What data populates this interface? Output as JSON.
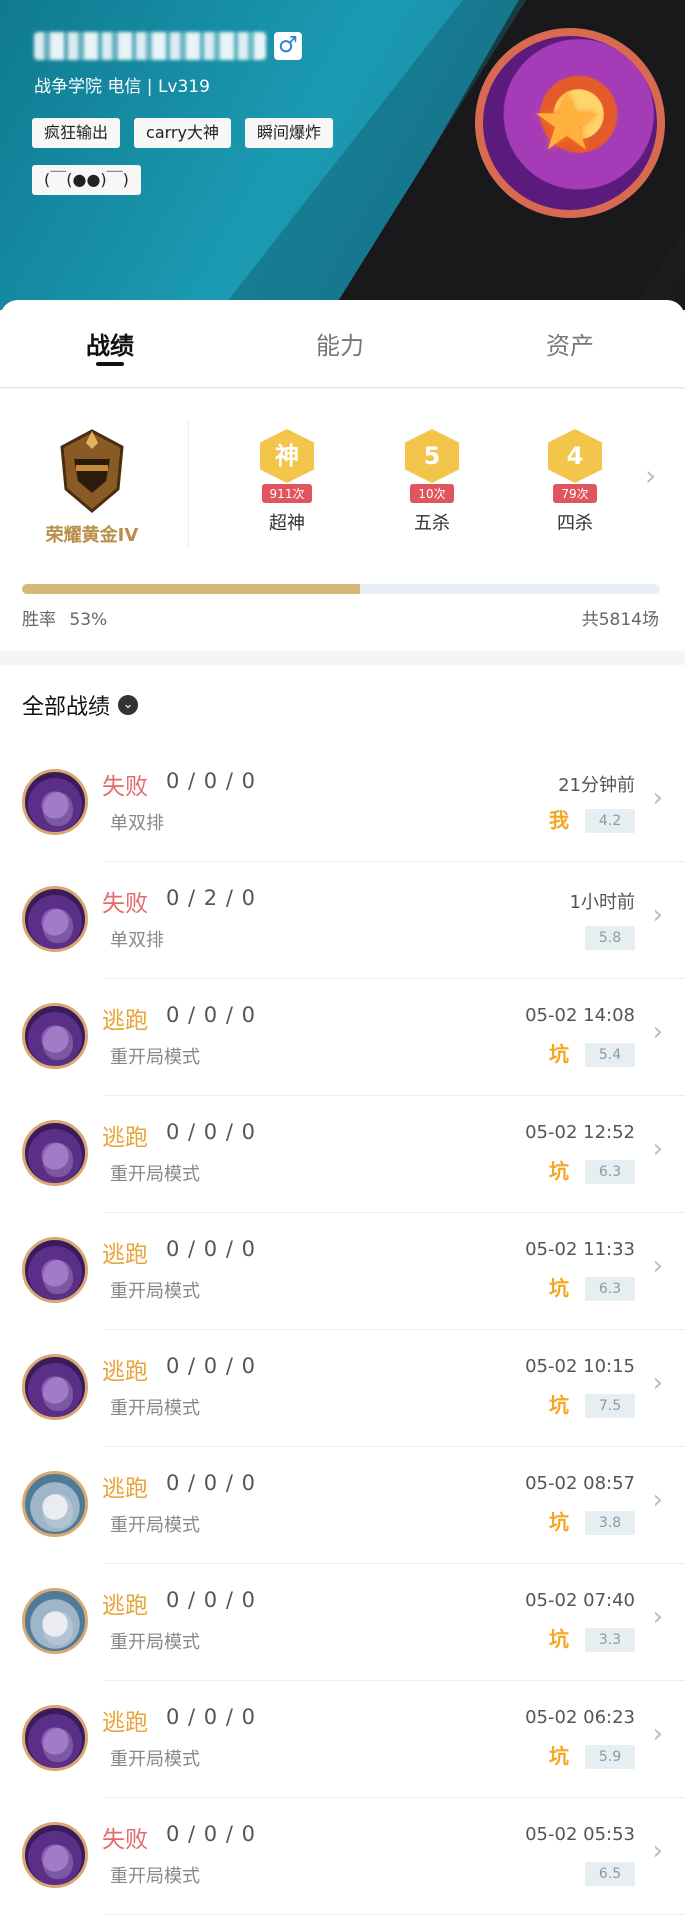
{
  "profile": {
    "subline": "战争学院 电信 | Lv319",
    "gender_icon": "male-icon",
    "tags": [
      "疯狂输出",
      "carry大神",
      "瞬间爆炸"
    ],
    "emoticon": "(￣(●●)￣)"
  },
  "tabs": [
    {
      "label": "战绩"
    },
    {
      "label": "能力"
    },
    {
      "label": "资产"
    }
  ],
  "stats": {
    "rank_label": "荣耀黄金IV",
    "achievements": [
      {
        "symbol": "神",
        "count": "911次",
        "label": "超神",
        "color": "#f3c54b"
      },
      {
        "symbol": "5",
        "count": "10次",
        "label": "五杀",
        "color": "#f3c54b"
      },
      {
        "symbol": "4",
        "count": "79次",
        "label": "四杀",
        "color": "#f3c54b"
      }
    ],
    "win_rate_label": "胜率",
    "win_rate_value": "53%",
    "win_rate_fraction": 0.53,
    "total": "共5814场"
  },
  "records": {
    "title": "全部战绩",
    "rows": [
      {
        "result": "失败",
        "type": "lose",
        "kda": "0 / 0 / 0",
        "mode": "单双排",
        "time": "21分钟前",
        "badge": "我",
        "score": "4.2",
        "avatar": "purple"
      },
      {
        "result": "失败",
        "type": "lose",
        "kda": "0 / 2 / 0",
        "mode": "单双排",
        "time": "1小时前",
        "badge": "",
        "score": "5.8",
        "avatar": "purple"
      },
      {
        "result": "逃跑",
        "type": "escape",
        "kda": "0 / 0 / 0",
        "mode": "重开局模式",
        "time": "05-02 14:08",
        "badge": "坑",
        "score": "5.4",
        "avatar": "purple"
      },
      {
        "result": "逃跑",
        "type": "escape",
        "kda": "0 / 0 / 0",
        "mode": "重开局模式",
        "time": "05-02 12:52",
        "badge": "坑",
        "score": "6.3",
        "avatar": "purple"
      },
      {
        "result": "逃跑",
        "type": "escape",
        "kda": "0 / 0 / 0",
        "mode": "重开局模式",
        "time": "05-02 11:33",
        "badge": "坑",
        "score": "6.3",
        "avatar": "purple"
      },
      {
        "result": "逃跑",
        "type": "escape",
        "kda": "0 / 0 / 0",
        "mode": "重开局模式",
        "time": "05-02 10:15",
        "badge": "坑",
        "score": "7.5",
        "avatar": "purple"
      },
      {
        "result": "逃跑",
        "type": "escape",
        "kda": "0 / 0 / 0",
        "mode": "重开局模式",
        "time": "05-02 08:57",
        "badge": "坑",
        "score": "3.8",
        "avatar": "icy"
      },
      {
        "result": "逃跑",
        "type": "escape",
        "kda": "0 / 0 / 0",
        "mode": "重开局模式",
        "time": "05-02 07:40",
        "badge": "坑",
        "score": "3.3",
        "avatar": "icy"
      },
      {
        "result": "逃跑",
        "type": "escape",
        "kda": "0 / 0 / 0",
        "mode": "重开局模式",
        "time": "05-02 06:23",
        "badge": "坑",
        "score": "5.9",
        "avatar": "purple"
      },
      {
        "result": "失败",
        "type": "lose",
        "kda": "0 / 0 / 0",
        "mode": "重开局模式",
        "time": "05-02 05:53",
        "badge": "",
        "score": "6.5",
        "avatar": "purple"
      }
    ]
  }
}
